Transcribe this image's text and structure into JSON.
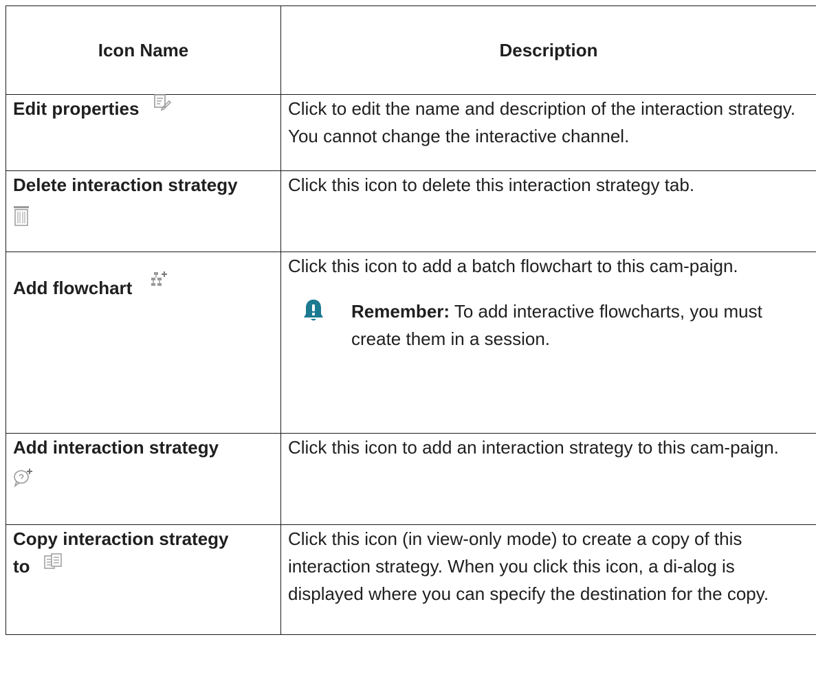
{
  "table": {
    "headers": {
      "name": "Icon Name",
      "description": "Description"
    },
    "rows": [
      {
        "name": "Edit properties",
        "icon": "edit-properties-icon",
        "description": "Click to edit the name and description of the interaction strategy. You cannot change the interactive channel."
      },
      {
        "name": "Delete interaction strategy",
        "icon": "trash-icon",
        "description": "Click this icon to delete this interaction strategy tab."
      },
      {
        "name": "Add flowchart",
        "icon": "add-flowchart-icon",
        "description": "Click this icon to add a batch flowchart to this cam-paign.",
        "note": {
          "label": "Remember:",
          "text": "To add interactive flowcharts, you must create them in a session.",
          "icon": "bell-alert-icon"
        }
      },
      {
        "name": "Add interaction strategy",
        "icon": "add-interaction-strategy-icon",
        "description": "Click this icon to add an interaction strategy to this cam-paign."
      },
      {
        "name_line1": "Copy interaction strategy",
        "name_line2": "to",
        "icon": "copy-icon",
        "description": "Click this icon (in view-only mode) to create a copy of this interaction strategy. When you click this icon, a di-alog is displayed where you can specify the destination for the copy."
      }
    ]
  },
  "colors": {
    "border": "#1a1a1a",
    "text": "#1f1f1f",
    "note_icon": "#1c7a91",
    "icon_gray": "#9a9a9a"
  }
}
